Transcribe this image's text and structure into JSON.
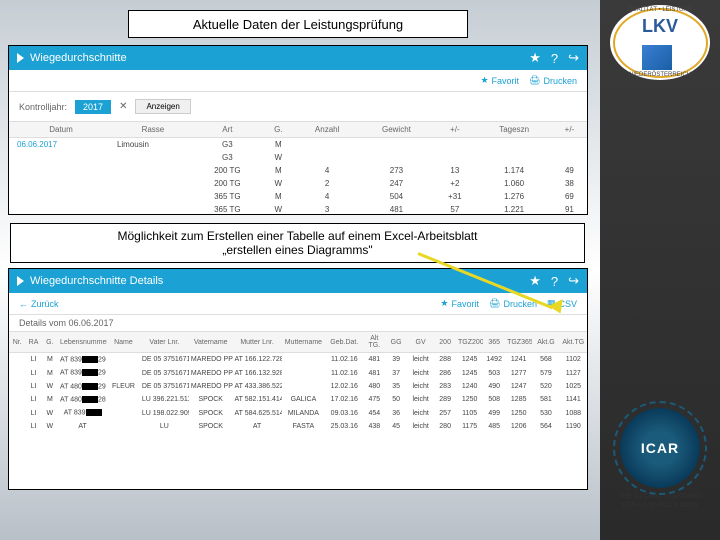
{
  "title": "Aktuelle Daten der Leistungsprüfung",
  "midtext_line1": "Möglichkeit zum Erstellen einer Tabelle auf einem Excel-Arbeitsblatt",
  "midtext_line2": "„erstellen eines Diagramms\"",
  "panel1": {
    "header": "Wiegedurchschnitte",
    "favorit": "Favorit",
    "drucken": "Drucken",
    "filter_label": "Kontrolljahr:",
    "filter_value": "2017",
    "filter_btn": "Anzeigen",
    "cols": [
      "Datum",
      "Rasse",
      "Art",
      "G.",
      "Anzahl",
      "Gewicht",
      "+/-",
      "Tageszn",
      "+/-"
    ],
    "date": "06.06.2017",
    "rasse": "Limousin",
    "rows": [
      {
        "art": "G3",
        "g": "M",
        "anzahl": "",
        "gewicht": "",
        "pm1": "",
        "tg": "",
        "pm2": ""
      },
      {
        "art": "G3",
        "g": "W",
        "anzahl": "",
        "gewicht": "",
        "pm1": "",
        "tg": "",
        "pm2": ""
      },
      {
        "art": "200 TG",
        "g": "M",
        "anzahl": "4",
        "gewicht": "273",
        "pm1": "13",
        "tg": "1.174",
        "pm2": "49"
      },
      {
        "art": "200 TG",
        "g": "W",
        "anzahl": "2",
        "gewicht": "247",
        "pm1": "+2",
        "tg": "1.060",
        "pm2": "38"
      },
      {
        "art": "365 TG",
        "g": "M",
        "anzahl": "4",
        "gewicht": "504",
        "pm1": "+31",
        "tg": "1.276",
        "pm2": "69"
      },
      {
        "art": "365 TG",
        "g": "W",
        "anzahl": "3",
        "gewicht": "481",
        "pm1": "57",
        "tg": "1.221",
        "pm2": "91"
      }
    ]
  },
  "panel2": {
    "header": "Wiegedurchschnitte Details",
    "zurueck": "Zurück",
    "favorit": "Favorit",
    "drucken": "Drucken",
    "csv": "CSV",
    "detail_date": "Details vom 06.06.2017",
    "cols": [
      "Nr.",
      "RA",
      "G.",
      "Lebensnummer",
      "Name",
      "Vater Lnr.",
      "Vatername",
      "Mutter Lnr.",
      "Muttername",
      "Geb.Dat.",
      "Alt TG.",
      "GG",
      "GV",
      "200",
      "TGZ200",
      "365",
      "TGZ365",
      "Akt.G",
      "Akt.TG"
    ],
    "rows": [
      {
        "ra": "LI",
        "g": "M",
        "ln": "AT 839███29",
        "name": "",
        "vlnr": "DE 05 37516712.",
        "vname": "MAREDO PP",
        "mlnr": "AT 166.122.728",
        "mname": "",
        "geb": "11.02.16",
        "alt": "481",
        "gg": "39",
        "gv": "leicht",
        "t200": "288",
        "tgz200": "1245",
        "t365": "1492",
        "tgz365": "1241",
        "aktg": "568",
        "akttg": "1102"
      },
      {
        "ra": "LI",
        "g": "M",
        "ln": "AT 839███29",
        "name": "",
        "vlnr": "DE 05 37516712.",
        "vname": "MAREDO PP",
        "mlnr": "AT 166.132.928",
        "mname": "",
        "geb": "11.02.16",
        "alt": "481",
        "gg": "37",
        "gv": "leicht",
        "t200": "286",
        "tgz200": "1245",
        "t365": "503",
        "tgz365": "1277",
        "aktg": "579",
        "akttg": "1127"
      },
      {
        "ra": "LI",
        "g": "W",
        "ln": "AT 480███29",
        "name": "FLEUR",
        "vlnr": "DE 05 37516712.",
        "vname": "MAREDO PP",
        "mlnr": "AT 433.386.522",
        "mname": "",
        "geb": "12.02.16",
        "alt": "480",
        "gg": "35",
        "gv": "leicht",
        "t200": "283",
        "tgz200": "1240",
        "t365": "490",
        "tgz365": "1247",
        "aktg": "520",
        "akttg": "1025"
      },
      {
        "ra": "LI",
        "g": "M",
        "ln": "AT 480███28",
        "name": "",
        "vlnr": "LU 396.221.511",
        "vname": "SPOCK",
        "mlnr": "AT 582.151.414",
        "mname": "GALICA",
        "geb": "17.02.16",
        "alt": "475",
        "gg": "50",
        "gv": "leicht",
        "t200": "289",
        "tgz200": "1250",
        "t365": "508",
        "tgz365": "1285",
        "aktg": "581",
        "akttg": "1141"
      },
      {
        "ra": "LI",
        "g": "W",
        "ln": "AT 839███",
        "name": "",
        "vlnr": "LU 198.022.909",
        "vname": "SPOCK",
        "mlnr": "AT 584.625.514",
        "mname": "MILANDA",
        "geb": "09.03.16",
        "alt": "454",
        "gg": "36",
        "gv": "leicht",
        "t200": "257",
        "tgz200": "1105",
        "t365": "499",
        "tgz365": "1250",
        "aktg": "530",
        "akttg": "1088"
      },
      {
        "ra": "LI",
        "g": "W",
        "ln": "AT",
        "name": "",
        "vlnr": "LU",
        "vname": "SPOCK",
        "mlnr": "AT",
        "mname": "FASTA",
        "geb": "25.03.16",
        "alt": "438",
        "gg": "45",
        "gv": "leicht",
        "t200": "280",
        "tgz200": "1175",
        "t365": "485",
        "tgz365": "1206",
        "aktg": "564",
        "akttg": "1190"
      }
    ]
  },
  "lkv": {
    "brand": "LKV",
    "ring_top": "QUALITÄT • LEISTUNG",
    "ring_bottom": "NIEDERÖSTERREICH"
  },
  "icar": {
    "brand": "ICAR",
    "sub": "THE GLOBAL STANDARD FOR LIVESTOCK DATA"
  },
  "icons": {
    "star": "★",
    "help": "?",
    "exit": "↪",
    "print": "🖨",
    "back": "←",
    "csv": "▦"
  }
}
